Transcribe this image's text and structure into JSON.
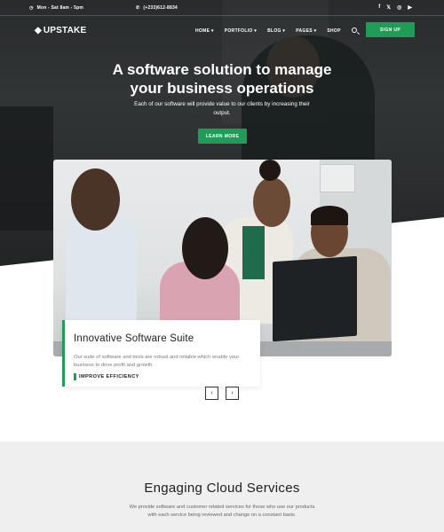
{
  "topbar": {
    "hours": "Mon - Sat 8am - 5pm",
    "phone": "(+233)612-8834",
    "social": [
      "f",
      "𝕏",
      "◎",
      "▶"
    ]
  },
  "nav": {
    "logo": "UPSTAKE",
    "menu": [
      "HOME",
      "PORTFOLIO",
      "BLOG",
      "PAGES",
      "SHOP"
    ],
    "signup": "SIGN UP"
  },
  "hero": {
    "title_line1": "A software solution to manage",
    "title_line2": "your business operations",
    "subtitle": "Each of our software will provide value to our clients by increasing their output.",
    "cta": "LEARN MORE"
  },
  "feature": {
    "title": "Innovative Software Suite",
    "text": "Our suite of software and tools are robust and reliable which enable your business to drive profit and growth.",
    "link": "IMPROVE EFFICIENCY"
  },
  "slider": {
    "prev": "‹",
    "next": "›"
  },
  "services": {
    "title": "Engaging Cloud Services",
    "text": "We provide software and customer related services for those who use our products with each service being reviewed and change on a constant basis."
  },
  "colors": {
    "accent": "#1f9d57"
  }
}
